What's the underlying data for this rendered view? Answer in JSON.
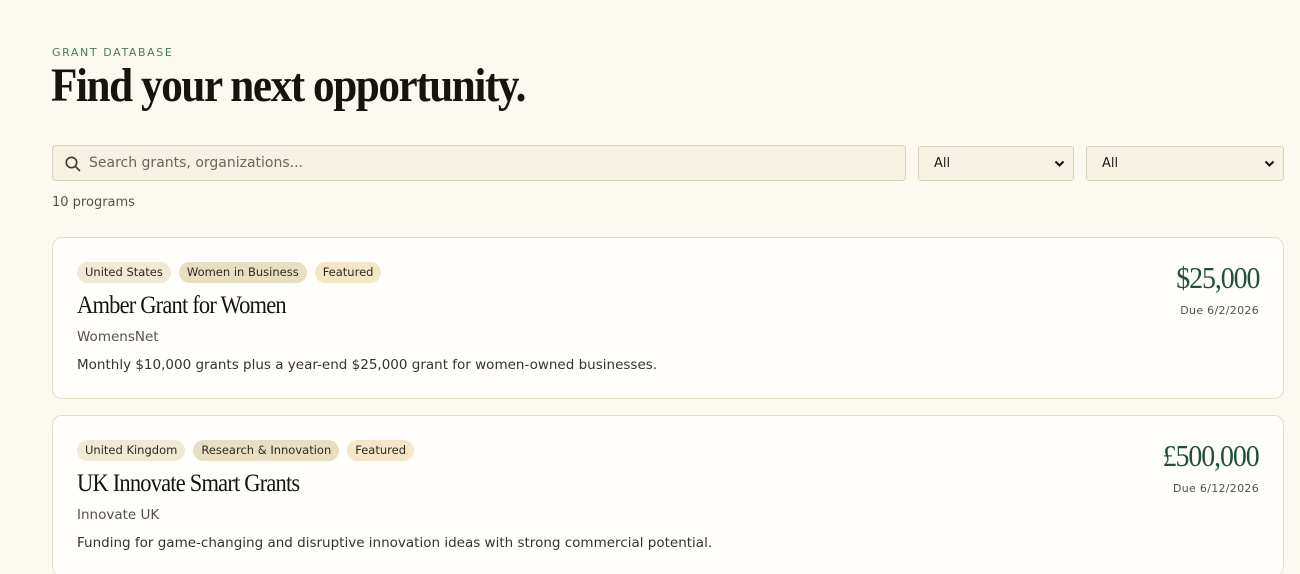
{
  "header": {
    "eyebrow": "GRANT DATABASE",
    "title": "Find your next opportunity."
  },
  "search": {
    "placeholder": "Search grants, organizations...",
    "value": "",
    "icon": "search-icon"
  },
  "filters": [
    {
      "selected": "All"
    },
    {
      "selected": "All"
    }
  ],
  "results": {
    "count_label": "10 programs"
  },
  "grants": [
    {
      "tags": [
        "United States",
        "Women in Business",
        "Featured"
      ],
      "name": "Amber Grant for Women",
      "organization": "WomensNet",
      "description": "Monthly $10,000 grants plus a year-end $25,000 grant for women-owned businesses.",
      "amount": "$25,000",
      "due": "Due 6/2/2026"
    },
    {
      "tags": [
        "United Kingdom",
        "Research & Innovation",
        "Featured"
      ],
      "name": "UK Innovate Smart Grants",
      "organization": "Innovate UK",
      "description": "Funding for game-changing and disruptive innovation ideas with strong commercial potential.",
      "amount": "£500,000",
      "due": "Due 6/12/2026"
    }
  ],
  "colors": {
    "background": "#fcf9f1",
    "accent_green": "#1f4f3e",
    "eyebrow_green": "#4e7a63",
    "tag_bg": "#efe9d6",
    "card_bg": "#fffefb",
    "input_bg": "#f6f1e1"
  }
}
